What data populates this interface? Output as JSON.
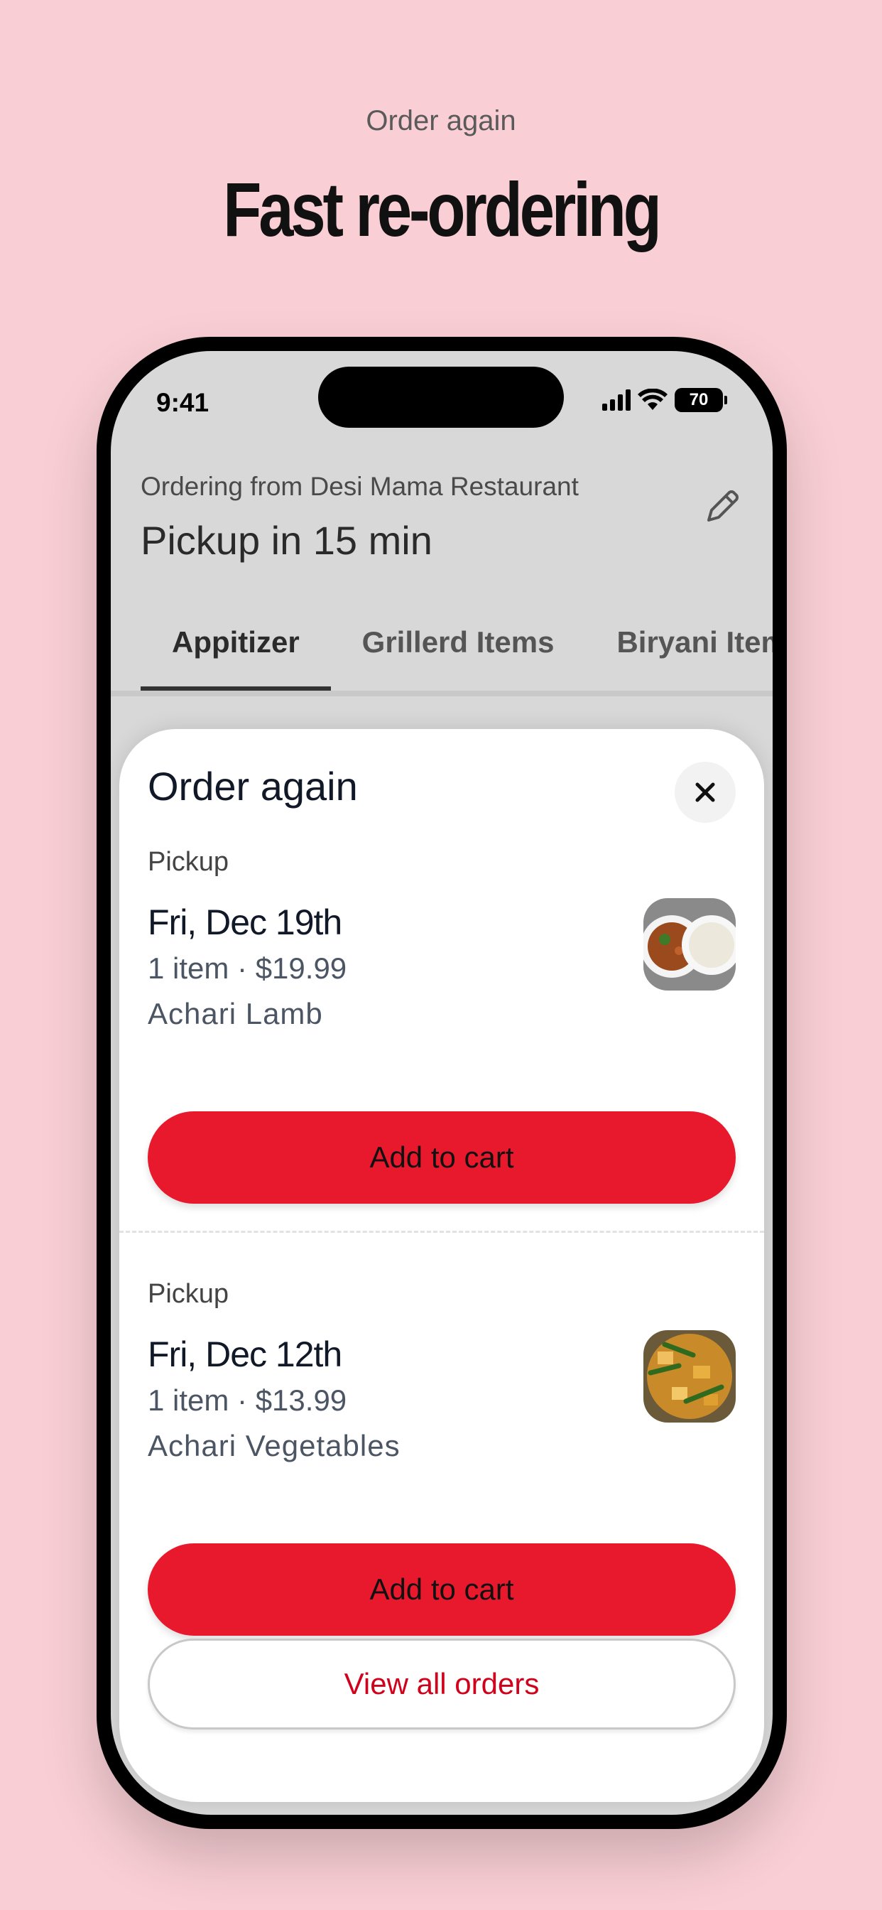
{
  "hero": {
    "eyebrow": "Order again",
    "title": "Fast re-ordering"
  },
  "status_bar": {
    "time": "9:41",
    "battery": "70",
    "icons": [
      "signal-icon",
      "wifi-icon",
      "battery-icon"
    ]
  },
  "header": {
    "ordering_from": "Ordering from Desi Mama Restaurant",
    "pickup_time": "Pickup in 15 min",
    "edit_icon": "pencil-icon"
  },
  "tabs": [
    {
      "label": "Appitizer",
      "active": true
    },
    {
      "label": "Grillerd Items",
      "active": false
    },
    {
      "label": "Biryani Items",
      "active": false
    }
  ],
  "sheet": {
    "title": "Order again",
    "close_icon": "close-icon",
    "orders": [
      {
        "type": "Pickup",
        "date": "Fri, Dec 19th",
        "summary": "1 item · $19.99",
        "item": "Achari Lamb",
        "button": "Add to cart"
      },
      {
        "type": "Pickup",
        "date": "Fri, Dec 12th",
        "summary": "1 item · $13.99",
        "item": "Achari Vegetables",
        "button": "Add to cart"
      }
    ],
    "view_all": "View all orders"
  },
  "colors": {
    "background": "#f9cfd5",
    "accent": "#e8192c",
    "link": "#d0021b"
  }
}
